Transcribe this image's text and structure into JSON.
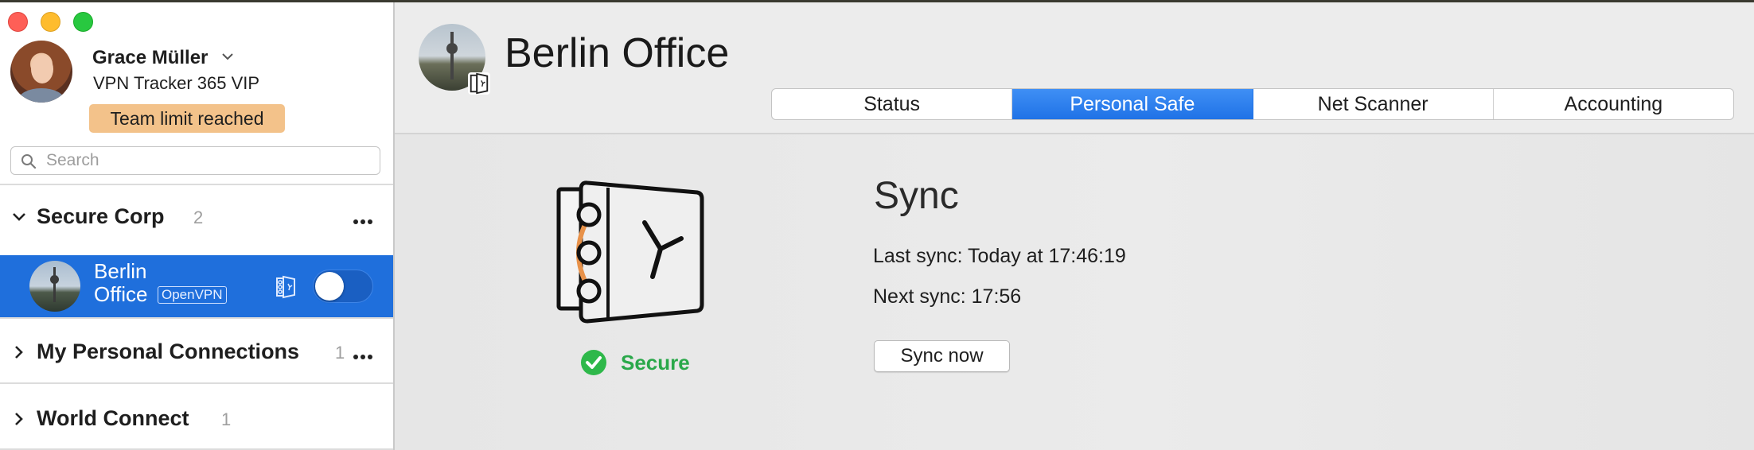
{
  "window": {
    "controls": [
      "close",
      "minimize",
      "zoom"
    ]
  },
  "user": {
    "name": "Grace Müller",
    "plan": "VPN Tracker 365 VIP",
    "badge": "Team limit reached",
    "badge_color": "#f3c28a"
  },
  "search": {
    "placeholder": "Search",
    "value": ""
  },
  "groups": [
    {
      "name": "Secure Corp",
      "count": "2",
      "expanded": true,
      "connections": [
        {
          "name": "Berlin Office",
          "protocol": "OpenVPN",
          "enabled": true,
          "selected": true
        }
      ]
    },
    {
      "name": "My Personal Connections",
      "count": "1",
      "expanded": false
    },
    {
      "name": "World Connect",
      "count": "1",
      "expanded": false
    }
  ],
  "main": {
    "title": "Berlin Office",
    "tabs": [
      {
        "label": "Status",
        "active": false
      },
      {
        "label": "Personal Safe",
        "active": true
      },
      {
        "label": "Net Scanner",
        "active": false
      },
      {
        "label": "Accounting",
        "active": false
      }
    ],
    "status": "Secure",
    "sync": {
      "title": "Sync",
      "last_sync": "Last sync: Today at 17:46:19",
      "next_sync": "Next sync: 17:56",
      "button": "Sync now"
    }
  },
  "colors": {
    "selection": "#1f6fdc",
    "tab_active": "#2a7ff0",
    "secure": "#2eb84a",
    "safe_accent": "#e8924a"
  },
  "icons": {
    "search": "magnifier-icon",
    "safe": "safe-icon",
    "check": "checkmark-icon",
    "more": "ellipsis-icon"
  }
}
